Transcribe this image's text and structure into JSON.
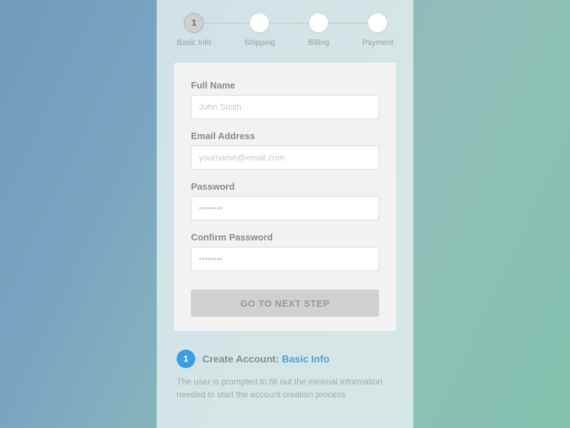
{
  "stepper": {
    "steps": [
      {
        "num": "1",
        "label": "Basic Info",
        "active": true
      },
      {
        "num": "",
        "label": "Shipping",
        "active": false
      },
      {
        "num": "",
        "label": "Billing",
        "active": false
      },
      {
        "num": "",
        "label": "Payment",
        "active": false
      }
    ]
  },
  "form": {
    "fullname_label": "Full Name",
    "fullname_placeholder": "John Smith",
    "email_label": "Email Address",
    "email_placeholder": "yourname@email.com",
    "password_label": "Password",
    "password_placeholder": "••••••••",
    "confirm_label": "Confirm Password",
    "confirm_placeholder": "••••••••",
    "submit_label": "GO TO NEXT STEP"
  },
  "footnote": {
    "badge": "1",
    "title_prefix": "Create Account: ",
    "title_accent": "Basic Info",
    "description": "The user is prompted to fill out the minimal information needed to start the account creation process"
  }
}
